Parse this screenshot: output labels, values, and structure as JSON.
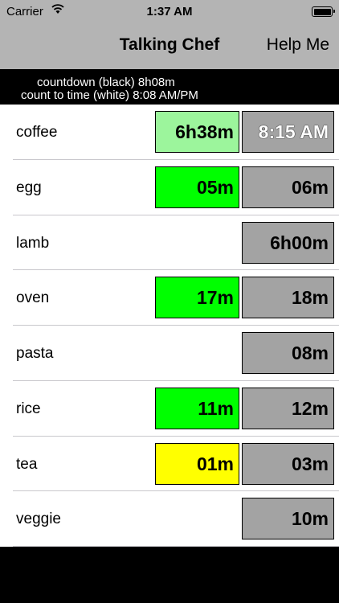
{
  "status_bar": {
    "carrier": "Carrier",
    "time": "1:37 AM",
    "wifi_icon": "wifi-icon",
    "battery_icon": "battery-icon"
  },
  "nav": {
    "title": "Talking Chef",
    "help_label": "Help Me"
  },
  "info": {
    "line1": "countdown (black) 8h08m",
    "line2": "count to time (white) 8:08 AM/PM"
  },
  "colors": {
    "light_green": "#9cf59c",
    "green": "#00ff00",
    "yellow": "#ffff00",
    "gray_box": "#a3a3a3",
    "bar_gray": "#b4b4b4"
  },
  "items": [
    {
      "name": "coffee",
      "countdown": "6h38m",
      "countdown_color": "#9cf59c",
      "count_to": "8:15 AM",
      "count_to_white": true
    },
    {
      "name": "egg",
      "countdown": "05m",
      "countdown_color": "#00ff00",
      "count_to": "06m",
      "count_to_white": false
    },
    {
      "name": "lamb",
      "countdown": "",
      "countdown_color": "",
      "count_to": "6h00m",
      "count_to_white": false
    },
    {
      "name": "oven",
      "countdown": "17m",
      "countdown_color": "#00ff00",
      "count_to": "18m",
      "count_to_white": false
    },
    {
      "name": "pasta",
      "countdown": "",
      "countdown_color": "",
      "count_to": "08m",
      "count_to_white": false
    },
    {
      "name": "rice",
      "countdown": "11m",
      "countdown_color": "#00ff00",
      "count_to": "12m",
      "count_to_white": false
    },
    {
      "name": "tea",
      "countdown": "01m",
      "countdown_color": "#ffff00",
      "count_to": "03m",
      "count_to_white": false
    },
    {
      "name": "veggie",
      "countdown": "",
      "countdown_color": "",
      "count_to": "10m",
      "count_to_white": false
    }
  ]
}
